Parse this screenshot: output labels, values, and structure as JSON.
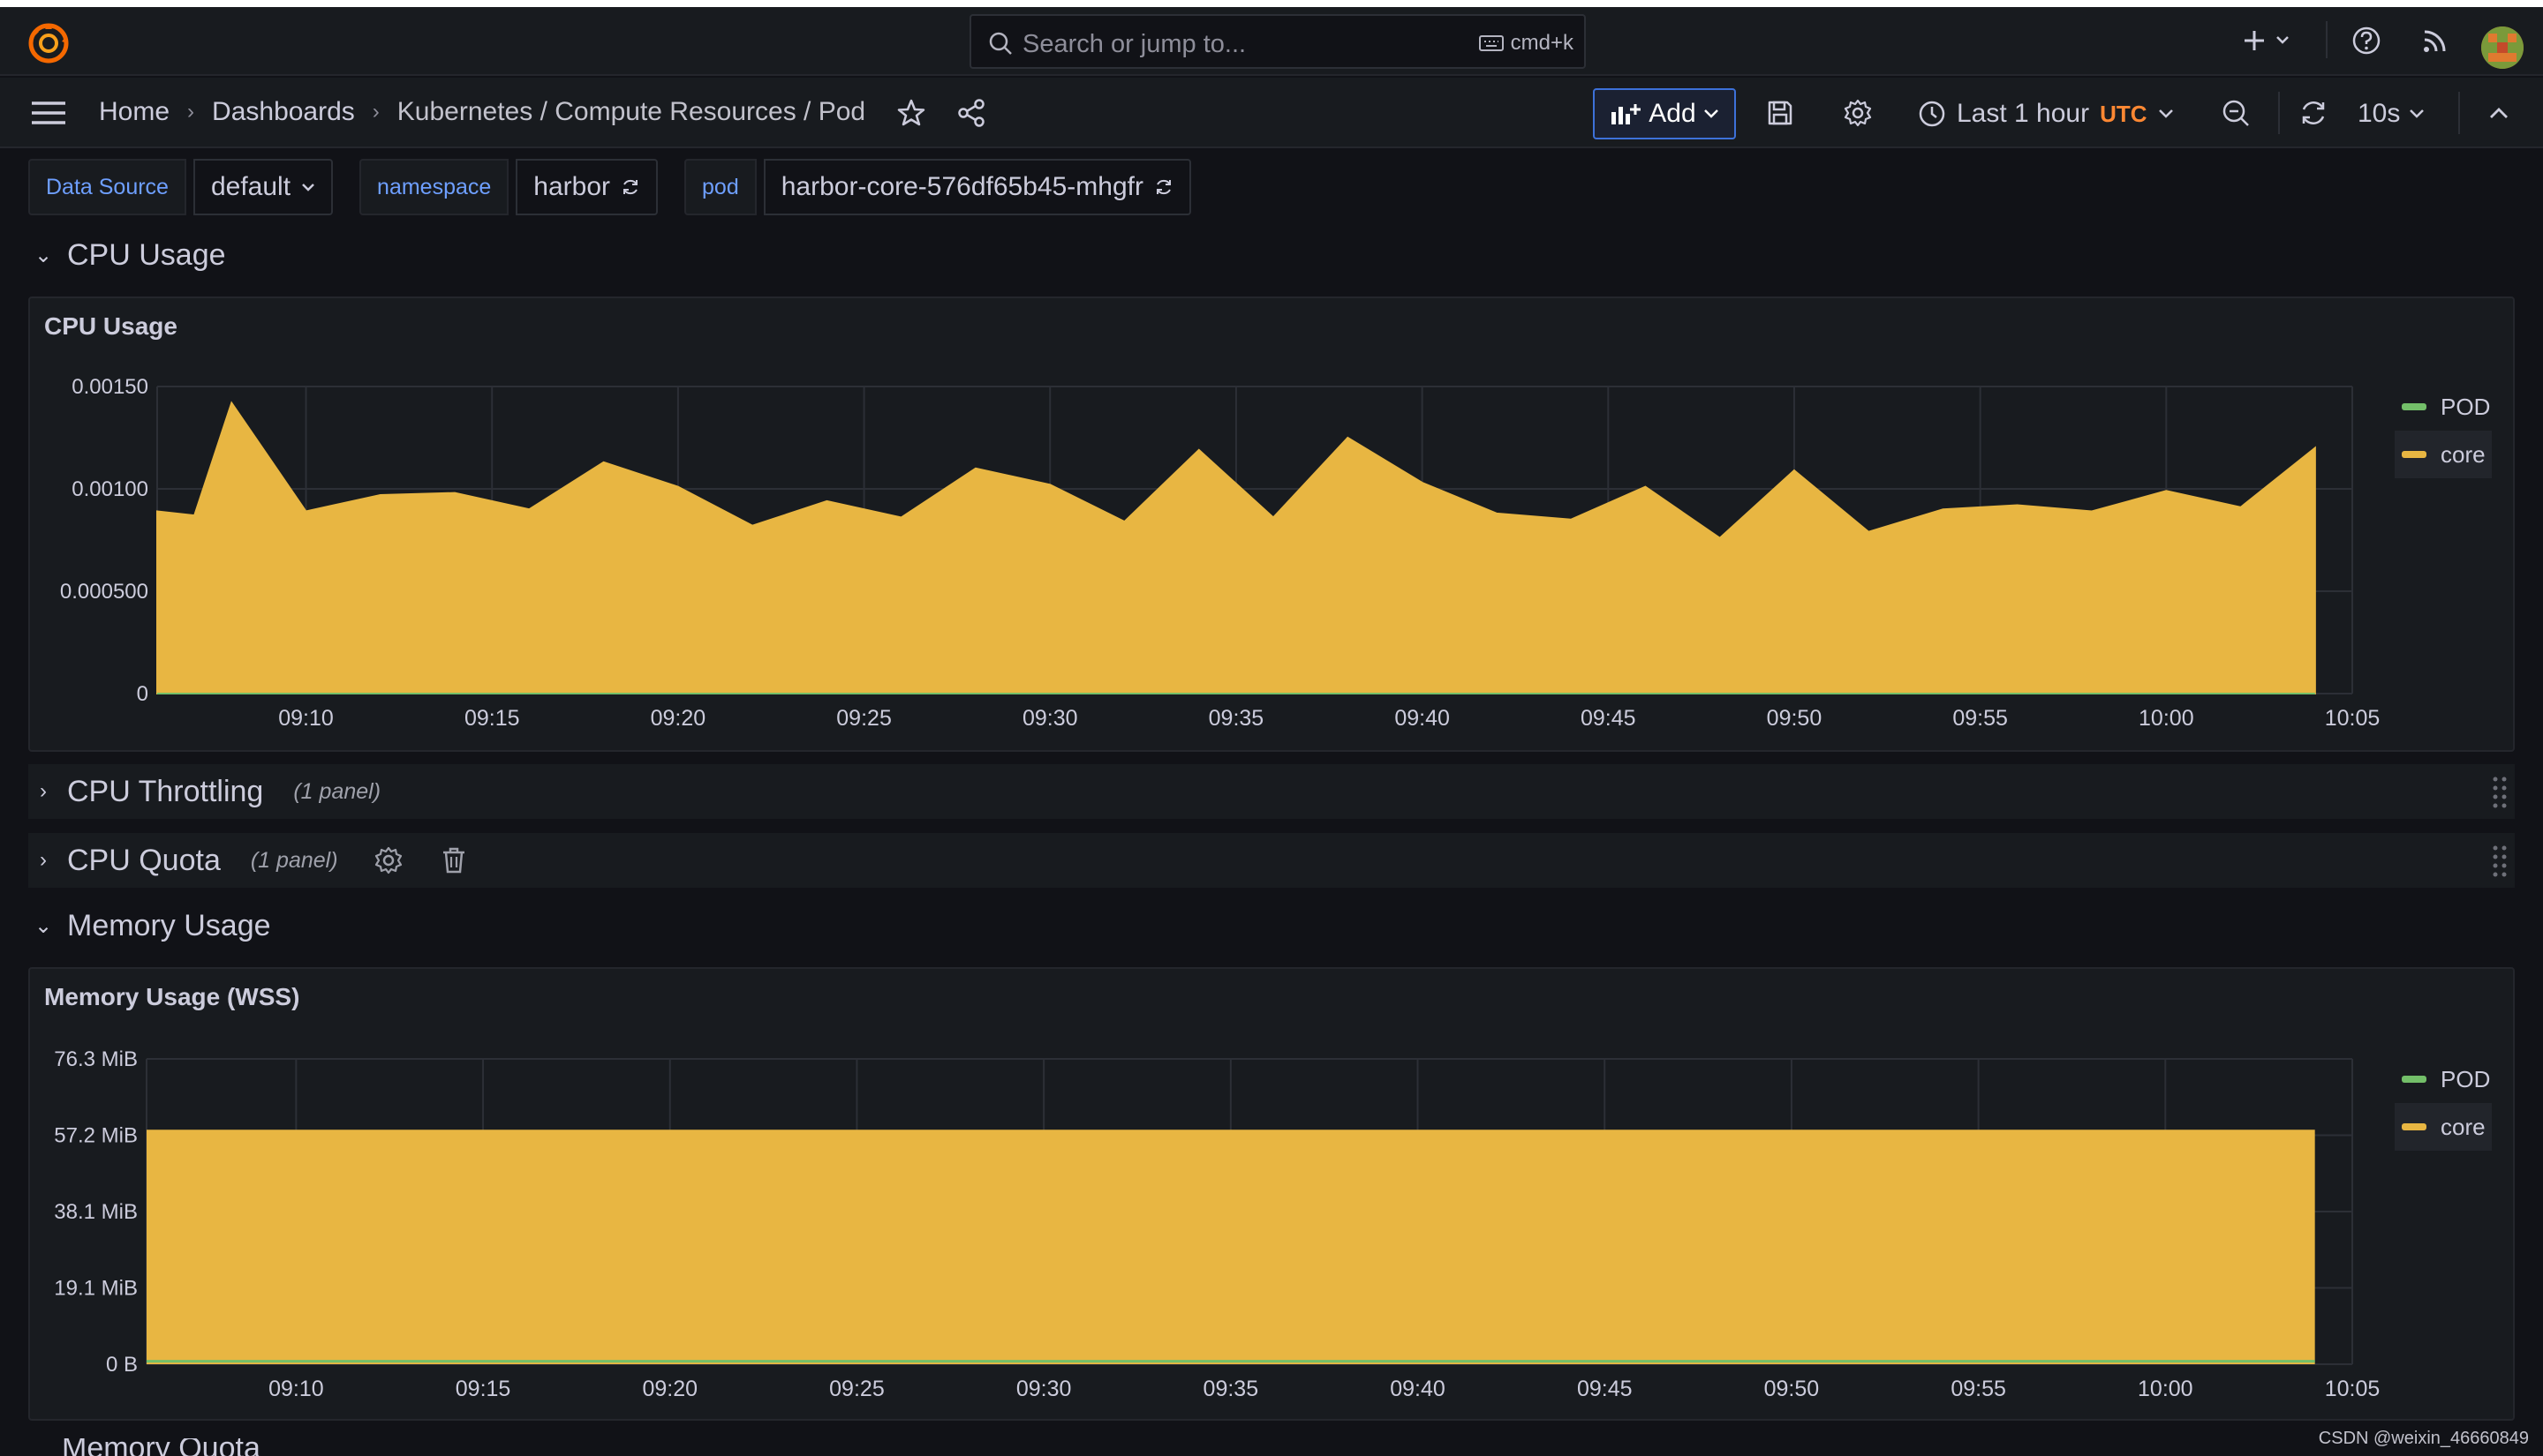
{
  "colors": {
    "accent": "#3d71d9",
    "series_core": "#e8b642",
    "series_pod": "#73bf69",
    "utc": "#ff8833",
    "bg": "#111217",
    "panel": "#181b1f"
  },
  "topbar": {
    "search_placeholder": "Search or jump to...",
    "shortcut": "cmd+k",
    "icons": [
      "grafana-logo-icon",
      "plus-icon",
      "help-icon",
      "news-rss-icon",
      "avatar"
    ]
  },
  "nav": {
    "breadcrumbs": [
      "Home",
      "Dashboards",
      "Kubernetes / Compute Resources / Pod"
    ],
    "add_label": "Add",
    "time_range": "Last 1 hour",
    "timezone": "UTC",
    "refresh_interval": "10s"
  },
  "variables": [
    {
      "label": "Data Source",
      "value": "default"
    },
    {
      "label": "namespace",
      "value": "harbor"
    },
    {
      "label": "pod",
      "value": "harbor-core-576df65b45-mhgfr"
    }
  ],
  "rows": {
    "cpu_usage": "CPU Usage",
    "cpu_throttling": "CPU Throttling",
    "cpu_throttling_meta": "(1 panel)",
    "cpu_quota": "CPU Quota",
    "cpu_quota_meta": "(1 panel)",
    "memory_usage": "Memory Usage",
    "memory_quota_peek": "Memory Quota"
  },
  "panels": {
    "cpu_title": "CPU Usage",
    "mem_title": "Memory Usage (WSS)"
  },
  "watermark": "CSDN @weixin_46660849",
  "chart_data": [
    {
      "type": "area",
      "title": "CPU Usage",
      "x_ticks": [
        "09:10",
        "09:15",
        "09:20",
        "09:25",
        "09:30",
        "09:35",
        "09:40",
        "09:45",
        "09:50",
        "09:55",
        "10:00",
        "10:05"
      ],
      "y_ticks": [
        "0",
        "0.000500",
        "0.00100",
        "0.00150"
      ],
      "ylim": [
        0,
        0.0015
      ],
      "x_minutes_range": [
        "09:06",
        "10:05"
      ],
      "series": [
        {
          "name": "POD",
          "x": [],
          "values": []
        },
        {
          "name": "core",
          "x": [
            "09:06",
            "09:07",
            "09:08",
            "09:10",
            "09:12",
            "09:14",
            "09:16",
            "09:18",
            "09:20",
            "09:22",
            "09:24",
            "09:26",
            "09:28",
            "09:30",
            "09:32",
            "09:34",
            "09:36",
            "09:38",
            "09:40",
            "09:42",
            "09:44",
            "09:46",
            "09:48",
            "09:50",
            "09:52",
            "09:54",
            "09:56",
            "09:58",
            "10:00",
            "10:02",
            "10:04"
          ],
          "values": [
            0.00089,
            0.00087,
            0.00142,
            0.00089,
            0.00097,
            0.00098,
            0.0009,
            0.00113,
            0.00101,
            0.00082,
            0.00094,
            0.00086,
            0.0011,
            0.00102,
            0.00084,
            0.00119,
            0.00086,
            0.00125,
            0.00103,
            0.00088,
            0.00085,
            0.00101,
            0.00076,
            0.00109,
            0.00079,
            0.0009,
            0.00092,
            0.00089,
            0.00099,
            0.00091,
            0.0012
          ]
        }
      ],
      "legend": [
        "POD",
        "core"
      ],
      "legend_position": "right",
      "grid": true
    },
    {
      "type": "area",
      "title": "Memory Usage (WSS)",
      "x_ticks": [
        "09:10",
        "09:15",
        "09:20",
        "09:25",
        "09:30",
        "09:35",
        "09:40",
        "09:45",
        "09:50",
        "09:55",
        "10:00",
        "10:05"
      ],
      "y_ticks": [
        "0 B",
        "19.1 MiB",
        "38.1 MiB",
        "57.2 MiB",
        "76.3 MiB"
      ],
      "ylim": [
        0,
        76.3
      ],
      "unit": "MiB",
      "series": [
        {
          "name": "POD",
          "values_start_end": [
            0.3,
            0.3
          ]
        },
        {
          "name": "core",
          "values_start_end": [
            58.6,
            58.6
          ]
        }
      ],
      "legend": [
        "POD",
        "core"
      ],
      "legend_position": "right",
      "grid": true
    }
  ]
}
